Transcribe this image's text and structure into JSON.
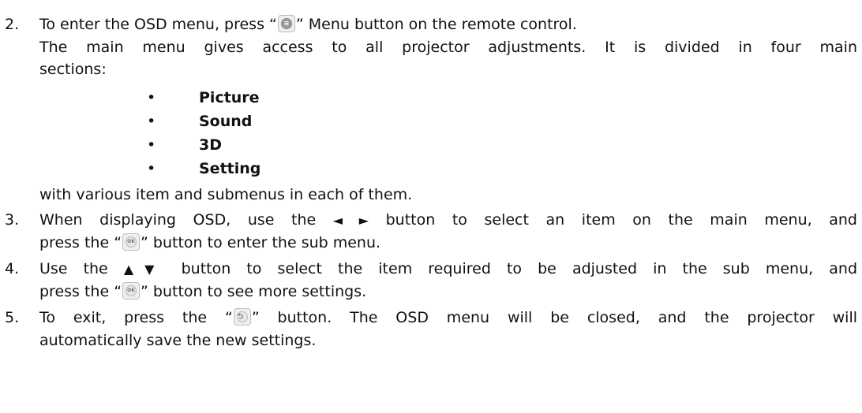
{
  "items": {
    "i2": {
      "number": "2.",
      "line1_a": "To enter the OSD menu, press “",
      "line1_b": "” Menu button on the remote control.",
      "line2": "The main menu gives access to all projector adjustments. It is divided in four main",
      "line3": "sections:",
      "sections": [
        "Picture",
        "Sound",
        "3D",
        "Setting"
      ],
      "after": "with various item and submenus in each of them."
    },
    "i3": {
      "number": "3.",
      "line1_a": "When displaying OSD, use the",
      "arrows": "◄ ►",
      "line1_b": "button to select an item on the main menu, and",
      "line2_a": "press the “",
      "line2_b": "” button to enter the sub menu."
    },
    "i4": {
      "number": "4.",
      "line1_a": "Use the",
      "arrows": "▲▼",
      "line1_b": "button to select the item required to be adjusted in the sub menu, and",
      "line2_a": "press the “",
      "line2_b": "” button to see more settings."
    },
    "i5": {
      "number": "5.",
      "line1_a": "To exit, press the “",
      "line1_b": "” button. The OSD menu will be closed, and the projector will",
      "line2": "automatically save the new settings."
    }
  },
  "icons": {
    "menu": "menu-button-icon",
    "ok": "ok-button-icon",
    "back": "return-button-icon",
    "ok_label": "OK"
  }
}
